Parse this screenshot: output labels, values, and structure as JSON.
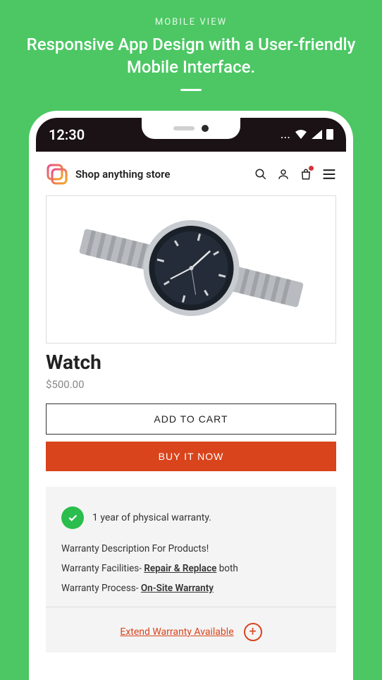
{
  "page": {
    "subtitle": "MOBILE VIEW",
    "title": "Responsive App Design with a User-friendly Mobile Interface."
  },
  "status": {
    "time": "12:30",
    "dots": "..."
  },
  "header": {
    "brand": "Shop anything store"
  },
  "product": {
    "name": "Watch",
    "price": "$500.00",
    "add_to_cart": "ADD TO CART",
    "buy_now": "BUY IT NOW"
  },
  "warranty": {
    "head": "1 year of physical warranty.",
    "desc": "Warranty Description For Products!",
    "facilities_label": "Warranty Facilities- ",
    "facilities_link": "Repair & Replace",
    "facilities_suffix": " both",
    "process_label": "Warranty Process- ",
    "process_link": "On-Site Warranty"
  },
  "extend": {
    "label": "Extend Warranty Available"
  }
}
